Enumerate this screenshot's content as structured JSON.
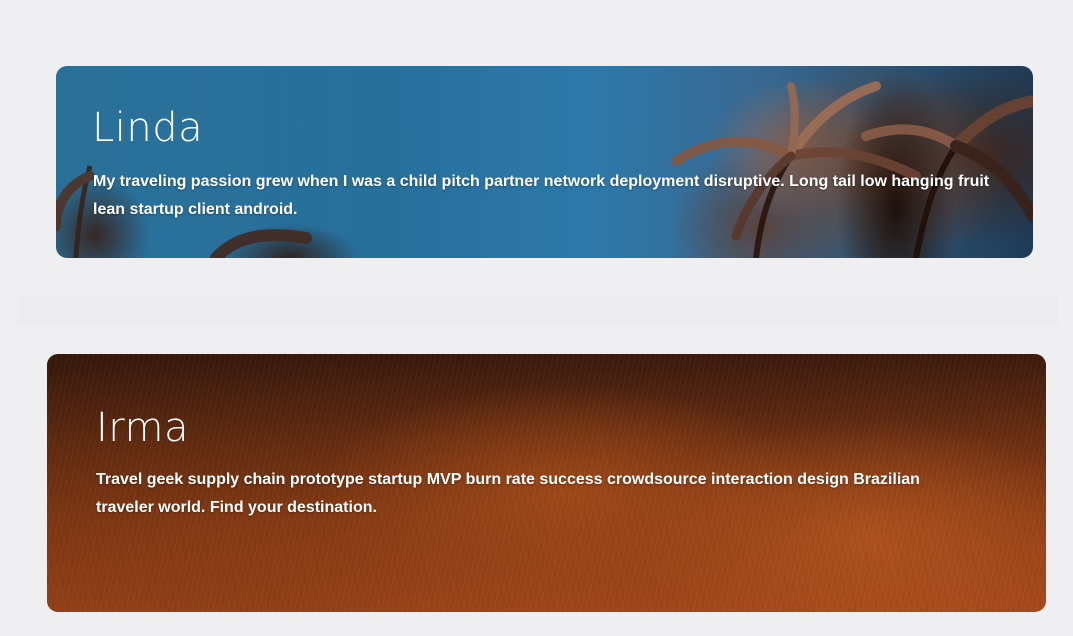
{
  "cards": [
    {
      "title": "Linda",
      "text": "My traveling passion grew when I was a child pitch partner network deployment disruptive. Long tail low hanging fruit lean startup client android."
    },
    {
      "title": "Irma",
      "text": "Travel geek supply chain prototype startup MVP burn rate success crowdsource interaction design Brazilian traveler world. Find your destination."
    }
  ],
  "colors": {
    "page_background": "#eeeef0",
    "linda_sky": "#2f7fae",
    "irma_field": "#8a3c15",
    "text": "#ffffff"
  }
}
